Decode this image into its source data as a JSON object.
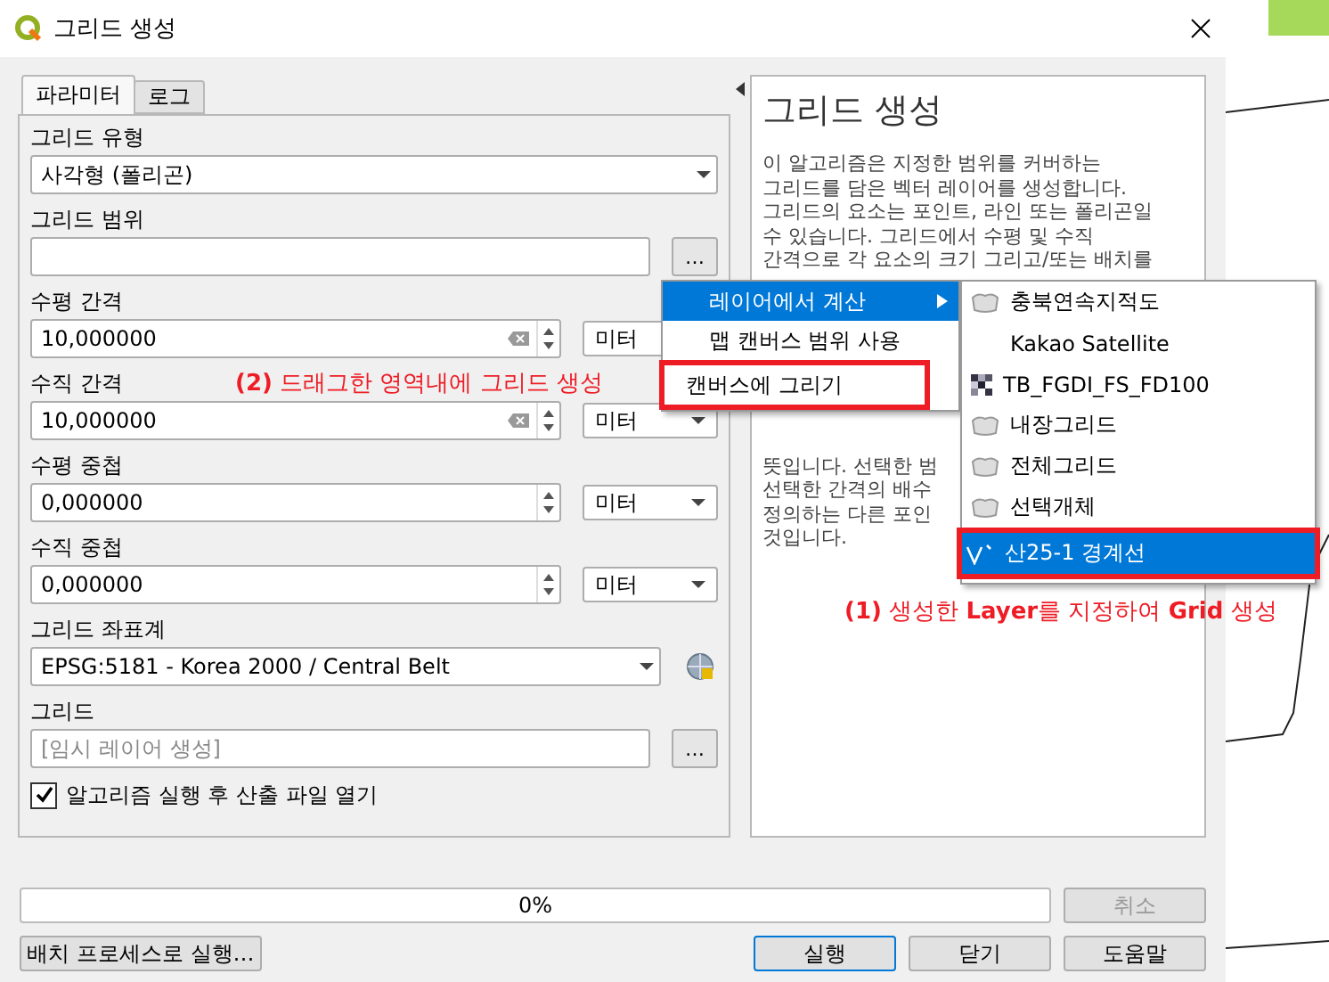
{
  "window": {
    "title": "그리드 생성"
  },
  "tabs": [
    {
      "label": "파라미터",
      "selected": true
    },
    {
      "label": "로그",
      "selected": false
    }
  ],
  "params": [
    {
      "kind": "select",
      "label": "그리드 유형",
      "value": "사각형 (폴리곤)"
    },
    {
      "kind": "extent",
      "label": "그리드 범위",
      "button": "…"
    },
    {
      "kind": "number",
      "label": "수평 간격",
      "value": "10,000000",
      "clearable": true,
      "unit": "미터"
    },
    {
      "kind": "number",
      "label": "수직 간격",
      "value": "10,000000",
      "clearable": true,
      "unit": "미터"
    },
    {
      "kind": "number",
      "label": "수평 중첩",
      "value": "0,000000",
      "clearable": false,
      "unit": "미터"
    },
    {
      "kind": "number",
      "label": "수직 중첩",
      "value": "0,000000",
      "clearable": false,
      "unit": "미터"
    },
    {
      "kind": "crs",
      "label": "그리드 좌표계",
      "value": "EPSG:5181 - Korea 2000 / Central Belt"
    },
    {
      "kind": "output",
      "label": "그리드",
      "placeholder": "[임시 레이어 생성]",
      "button": "…"
    },
    {
      "kind": "checkbox",
      "label": "알고리즘 실행 후 산출 파일 열기",
      "checked": true
    }
  ],
  "help": {
    "title": "그리드 생성",
    "lines_top": [
      "이 알고리즘은 지정한 범위를 커버하는",
      "그리드를 담은 벡터 레이어를 생성합니다.",
      "그리드의 요소는 포인트, 라인 또는 폴리곤일",
      "수 있습니다. 그리드에서 수평 및 수직",
      "간격으로 각 요소의 크기 그리고/또는 배치를"
    ],
    "lines_bottom": [
      "뜻입니다. 선택한 범",
      "선택한 간격의 배수",
      "정의하는 다른 포인",
      "것입니다."
    ]
  },
  "progress": {
    "level": 0,
    "text": "0%"
  },
  "cancel_button": {
    "label": "취소",
    "disabled": true
  },
  "batch_button": "배치 프로세스로 실행…",
  "buttons": [
    {
      "label": "실행",
      "default": true
    },
    {
      "label": "닫기",
      "default": false
    },
    {
      "label": "도움말",
      "default": false
    }
  ],
  "menu": {
    "items": [
      {
        "label": "레이어에서 계산",
        "selected": true,
        "submenu": true,
        "marked": false
      },
      {
        "label": "맵 캔버스 범위 사용",
        "selected": false,
        "submenu": false,
        "marked": false
      },
      {
        "label": "캔버스에 그리기",
        "selected": false,
        "submenu": false,
        "marked": true
      }
    ]
  },
  "submenu": {
    "items": [
      {
        "label": "충북연속지적도",
        "kind": "polygon",
        "selected": false,
        "marked": false
      },
      {
        "label": "Kakao Satellite",
        "kind": "plain",
        "selected": false,
        "marked": false
      },
      {
        "label": "TB_FGDI_FS_FD100",
        "kind": "raster",
        "selected": false,
        "marked": false
      },
      {
        "label": "내장그리드",
        "kind": "polygon",
        "selected": false,
        "marked": false
      },
      {
        "label": "전체그리드",
        "kind": "polygon",
        "selected": false,
        "marked": false
      },
      {
        "label": "선택개체",
        "kind": "polygon",
        "selected": false,
        "marked": false
      },
      {
        "label": "산25-1 경계선",
        "kind": "line",
        "selected": true,
        "marked": true
      }
    ]
  },
  "annotations": [
    {
      "text": "**(1)** 생성한 **Layer**를 지정하여 **Grid** 생성"
    },
    {
      "text": "**(2)** 드래그한 영역내에 그리드 생성"
    }
  ]
}
